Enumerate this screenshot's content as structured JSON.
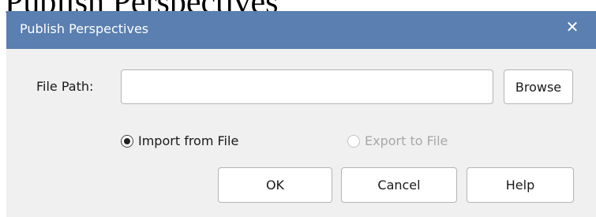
{
  "background": {
    "text": "Publish Perspectives"
  },
  "dialog": {
    "title": "Publish Perspectives",
    "close_glyph": "✕",
    "title_bar_color": "#5a7fb0",
    "file_path_label": "File Path:",
    "file_path_value": "",
    "file_path_placeholder": "",
    "browse_label": "Browse",
    "options": [
      {
        "label": "Import from File",
        "selected": true,
        "enabled": true
      },
      {
        "label": "Export to File",
        "selected": false,
        "enabled": false
      }
    ],
    "buttons": {
      "ok": "OK",
      "cancel": "Cancel",
      "help": "Help"
    }
  }
}
